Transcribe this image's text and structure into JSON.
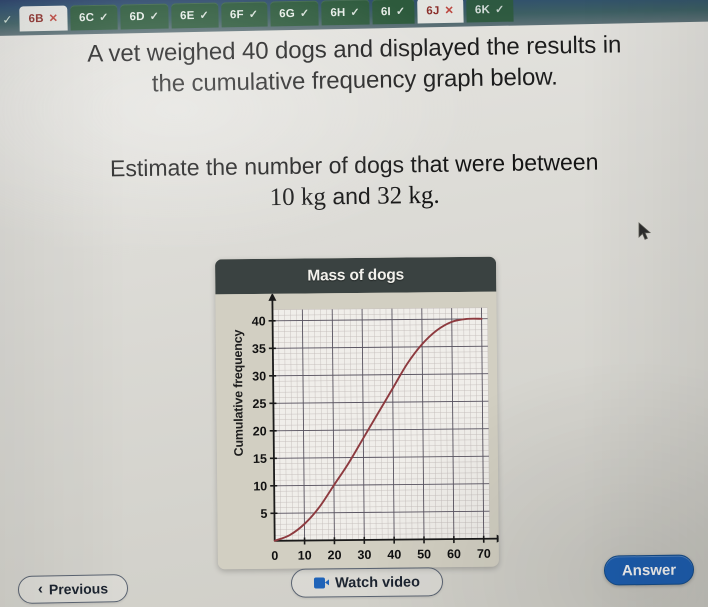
{
  "browser": {
    "tabs": [
      {
        "label": "",
        "mark": "check",
        "state": "normal",
        "partial": true
      },
      {
        "label": "6B",
        "mark": "close",
        "state": "selected",
        "partial": false
      },
      {
        "label": "6C",
        "mark": "check",
        "state": "normal",
        "partial": false
      },
      {
        "label": "6D",
        "mark": "check",
        "state": "normal",
        "partial": false
      },
      {
        "label": "6E",
        "mark": "check",
        "state": "normal",
        "partial": false
      },
      {
        "label": "6F",
        "mark": "check",
        "state": "normal",
        "partial": false
      },
      {
        "label": "6G",
        "mark": "check",
        "state": "normal",
        "partial": false
      },
      {
        "label": "6H",
        "mark": "check",
        "state": "normal",
        "partial": false
      },
      {
        "label": "6I",
        "mark": "check",
        "state": "normal",
        "partial": false
      },
      {
        "label": "6J",
        "mark": "close",
        "state": "selected",
        "partial": false
      },
      {
        "label": "6K",
        "mark": "check",
        "state": "normal",
        "partial": true
      }
    ],
    "check_glyph": "✓",
    "close_glyph": "✕"
  },
  "question": {
    "line1": "A vet weighed 40 dogs and displayed the results in",
    "line2": "the cumulative frequency graph below."
  },
  "prompt": {
    "line1": "Estimate the number of dogs that were between",
    "value1": "10",
    "unit1": "kg",
    "conjunction": "and",
    "value2": "32",
    "unit2": "kg",
    "period": "."
  },
  "chart_data": {
    "type": "line",
    "title": "Mass of dogs",
    "xlabel": "",
    "ylabel": "Cumulative frequency",
    "xlim": [
      0,
      72
    ],
    "ylim": [
      0,
      42
    ],
    "xticks": [
      0,
      10,
      20,
      30,
      40,
      50,
      60,
      70
    ],
    "xticklabels": [
      "0",
      "10",
      "20",
      "30",
      "40",
      "50",
      "60",
      "70"
    ],
    "yticks": [
      5,
      10,
      15,
      20,
      25,
      30,
      35,
      40
    ],
    "yticklabels": [
      "5",
      "10",
      "15",
      "20",
      "25",
      "30",
      "35",
      "40"
    ],
    "grid": true,
    "minor_grid": true,
    "legend": "none",
    "line_color": "#8d3a3f",
    "series": [
      {
        "name": "Cumulative frequency",
        "x": [
          0,
          5,
          10,
          15,
          20,
          25,
          30,
          35,
          40,
          45,
          50,
          55,
          60,
          65,
          70
        ],
        "y": [
          0,
          1,
          3,
          6,
          10,
          14,
          18.5,
          23,
          27.5,
          32,
          35.5,
          38,
          39.5,
          40,
          40
        ]
      }
    ]
  },
  "footer": {
    "previous_label": "Previous",
    "previous_chevron": "‹",
    "watch_video_label": "Watch video",
    "answer_label": "Answer"
  },
  "colors": {
    "tab_green": "#2d5a3c",
    "tab_selected": "#e3e4e0",
    "chart_header": "#3a4241",
    "chart_body": "#d2cfc2",
    "curve": "#8d3a3f",
    "answer_blue": "#1f63b8"
  }
}
